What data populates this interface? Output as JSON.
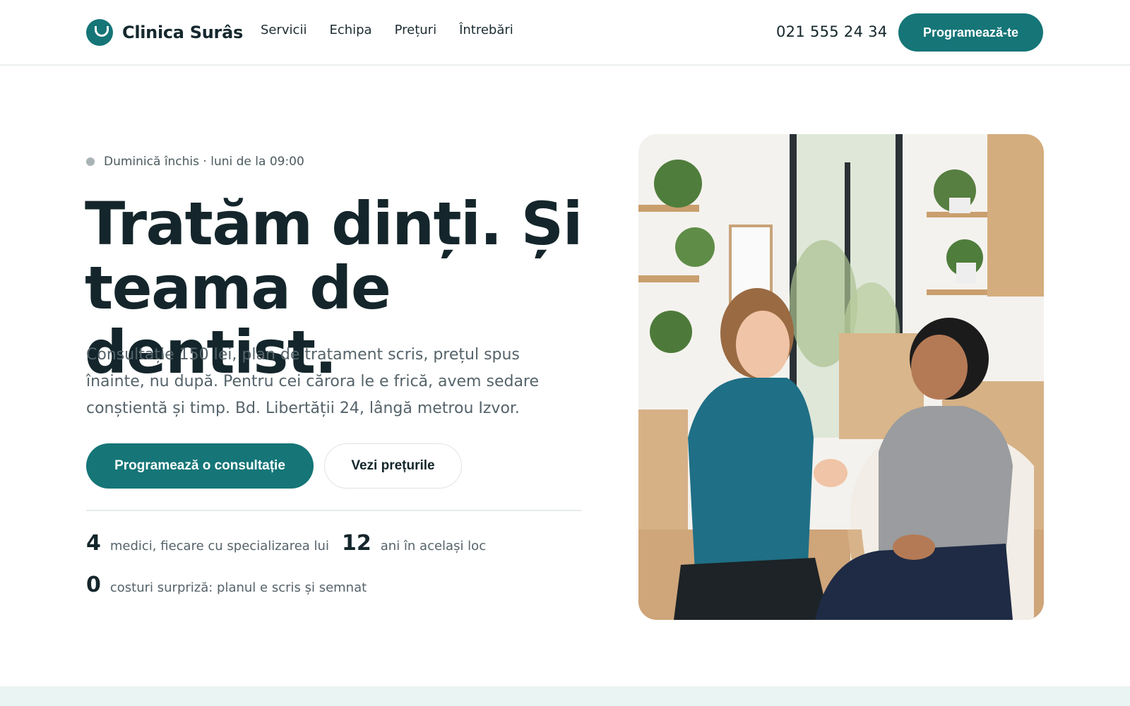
{
  "header": {
    "brand": "Clinica Surâs",
    "nav": [
      "Servicii",
      "Echipa",
      "Prețuri",
      "Întrebări"
    ],
    "phone": "021 555 24 34",
    "cta_label": "Programează-te"
  },
  "hero": {
    "hours_status": "Duminică închis · luni de la 09:00",
    "headline_line1": "Tratăm dinți. Și",
    "headline_line2": "teama de dentist.",
    "lead": "Consultație 150 lei, plan de tratament scris, prețul spus înainte, nu după. Pentru cei cărora le e frică, avem sedare conștientă și timp. Bd. Libertății 24, lângă metrou Izvor.",
    "primary_cta": "Programează o consultație",
    "secondary_cta": "Vezi prețurile",
    "stats": [
      {
        "number": "4",
        "label": "medici, fiecare cu specializarea lui"
      },
      {
        "number": "12",
        "label": "ani în același loc"
      },
      {
        "number": "0",
        "label": "costuri surpriză: planul e scris și semnat"
      }
    ]
  },
  "colors": {
    "accent": "#157577",
    "text": "#14262b",
    "muted": "#55636a",
    "band": "#eaf4f2"
  },
  "icons": {
    "logo": "smile-icon",
    "status": "status-dot-icon"
  }
}
